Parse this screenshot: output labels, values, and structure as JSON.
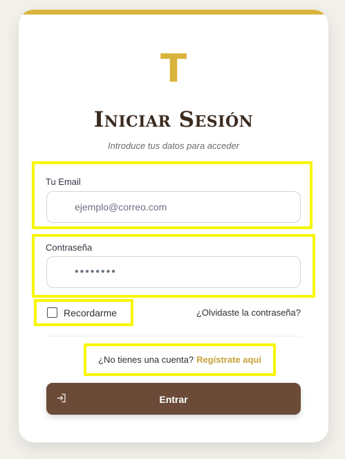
{
  "brand": {
    "logo_letter": "T",
    "accent_color": "#d8b43b"
  },
  "login": {
    "title": "Iniciar Sesión",
    "subtitle": "Introduce tus datos para acceder",
    "email": {
      "label": "Tu Email",
      "placeholder": "ejemplo@correo.com",
      "value": ""
    },
    "password": {
      "label": "Contraseña",
      "value": "••••••••"
    },
    "remember": {
      "label": "Recordarme",
      "checked": false
    },
    "forgot_link": "¿Olvidaste la contraseña?",
    "register": {
      "prompt": "¿No tienes una cuenta?",
      "link": "Regístrate aquí"
    },
    "submit": {
      "label": "Entrar",
      "icon": "sign-in-icon",
      "color": "#6b4b37"
    }
  }
}
